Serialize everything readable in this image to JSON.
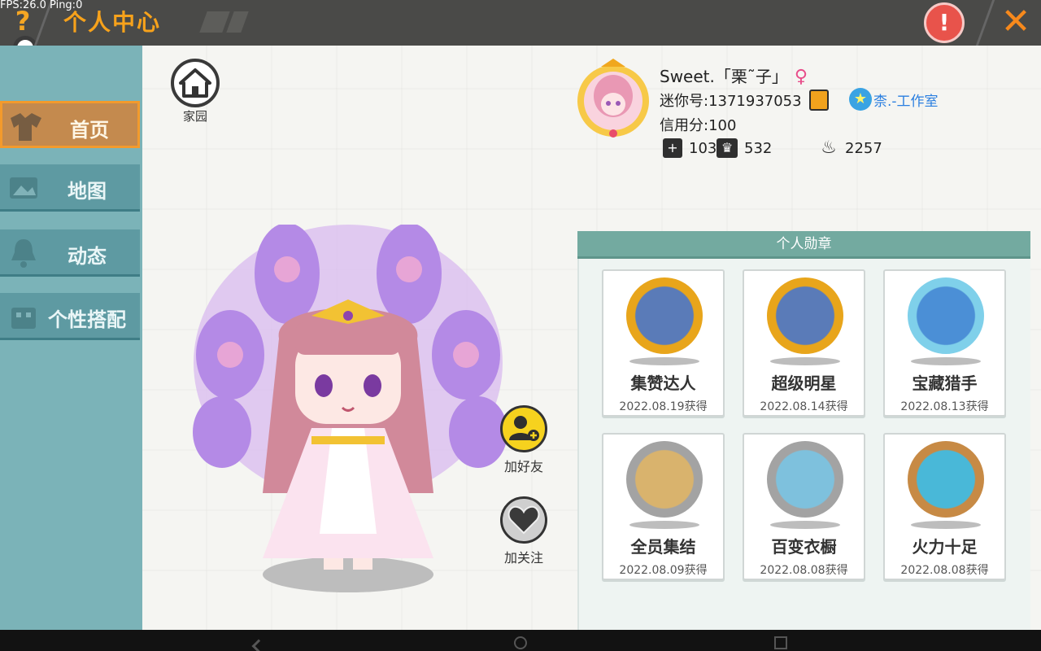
{
  "debug": {
    "fps_text": "FPS:26.0  Ping:0"
  },
  "header": {
    "title": "个人中心",
    "help_icon": "question-icon",
    "warn_icon": "warning-icon",
    "close_icon": "close-icon"
  },
  "sidebar": {
    "items": [
      {
        "label": "首页",
        "icon": "shirt-icon",
        "active": true
      },
      {
        "label": "地图",
        "icon": "map-icon",
        "active": false
      },
      {
        "label": "动态",
        "icon": "bell-icon",
        "active": false
      },
      {
        "label": "个性搭配",
        "icon": "outfit-icon",
        "active": false
      }
    ]
  },
  "home": {
    "label": "家园",
    "icon": "house-icon"
  },
  "profile": {
    "name": "Sweet.「栗˜子」",
    "gender_symbol": "♀",
    "mini_id": "迷你号:1371937053",
    "studio": "柰.-工作室",
    "credit": "信用分:100",
    "stats": [
      {
        "icon": "plus-bookmark-icon",
        "value": "103"
      },
      {
        "icon": "fans-icon",
        "value": "532"
      },
      {
        "icon": "fire-icon",
        "value": "2257"
      }
    ]
  },
  "actions": {
    "add_friend": "加好友",
    "follow": "加关注"
  },
  "medals": {
    "title": "个人勋章",
    "items": [
      {
        "name": "集赞达人",
        "date": "2022.08.19获得",
        "ring": "#e8a51b",
        "core": "#5a7bb8"
      },
      {
        "name": "超级明星",
        "date": "2022.08.14获得",
        "ring": "#e8a51b",
        "core": "#5a7bb8"
      },
      {
        "name": "宝藏猎手",
        "date": "2022.08.13获得",
        "ring": "#7fd0ea",
        "core": "#4b8fd6"
      },
      {
        "name": "全员集结",
        "date": "2022.08.09获得",
        "ring": "#a3a3a3",
        "core": "#d9b36d"
      },
      {
        "name": "百变衣橱",
        "date": "2022.08.08获得",
        "ring": "#a3a3a3",
        "core": "#7ec1dd"
      },
      {
        "name": "火力十足",
        "date": "2022.08.08获得",
        "ring": "#c78a45",
        "core": "#49b8d8"
      }
    ]
  }
}
